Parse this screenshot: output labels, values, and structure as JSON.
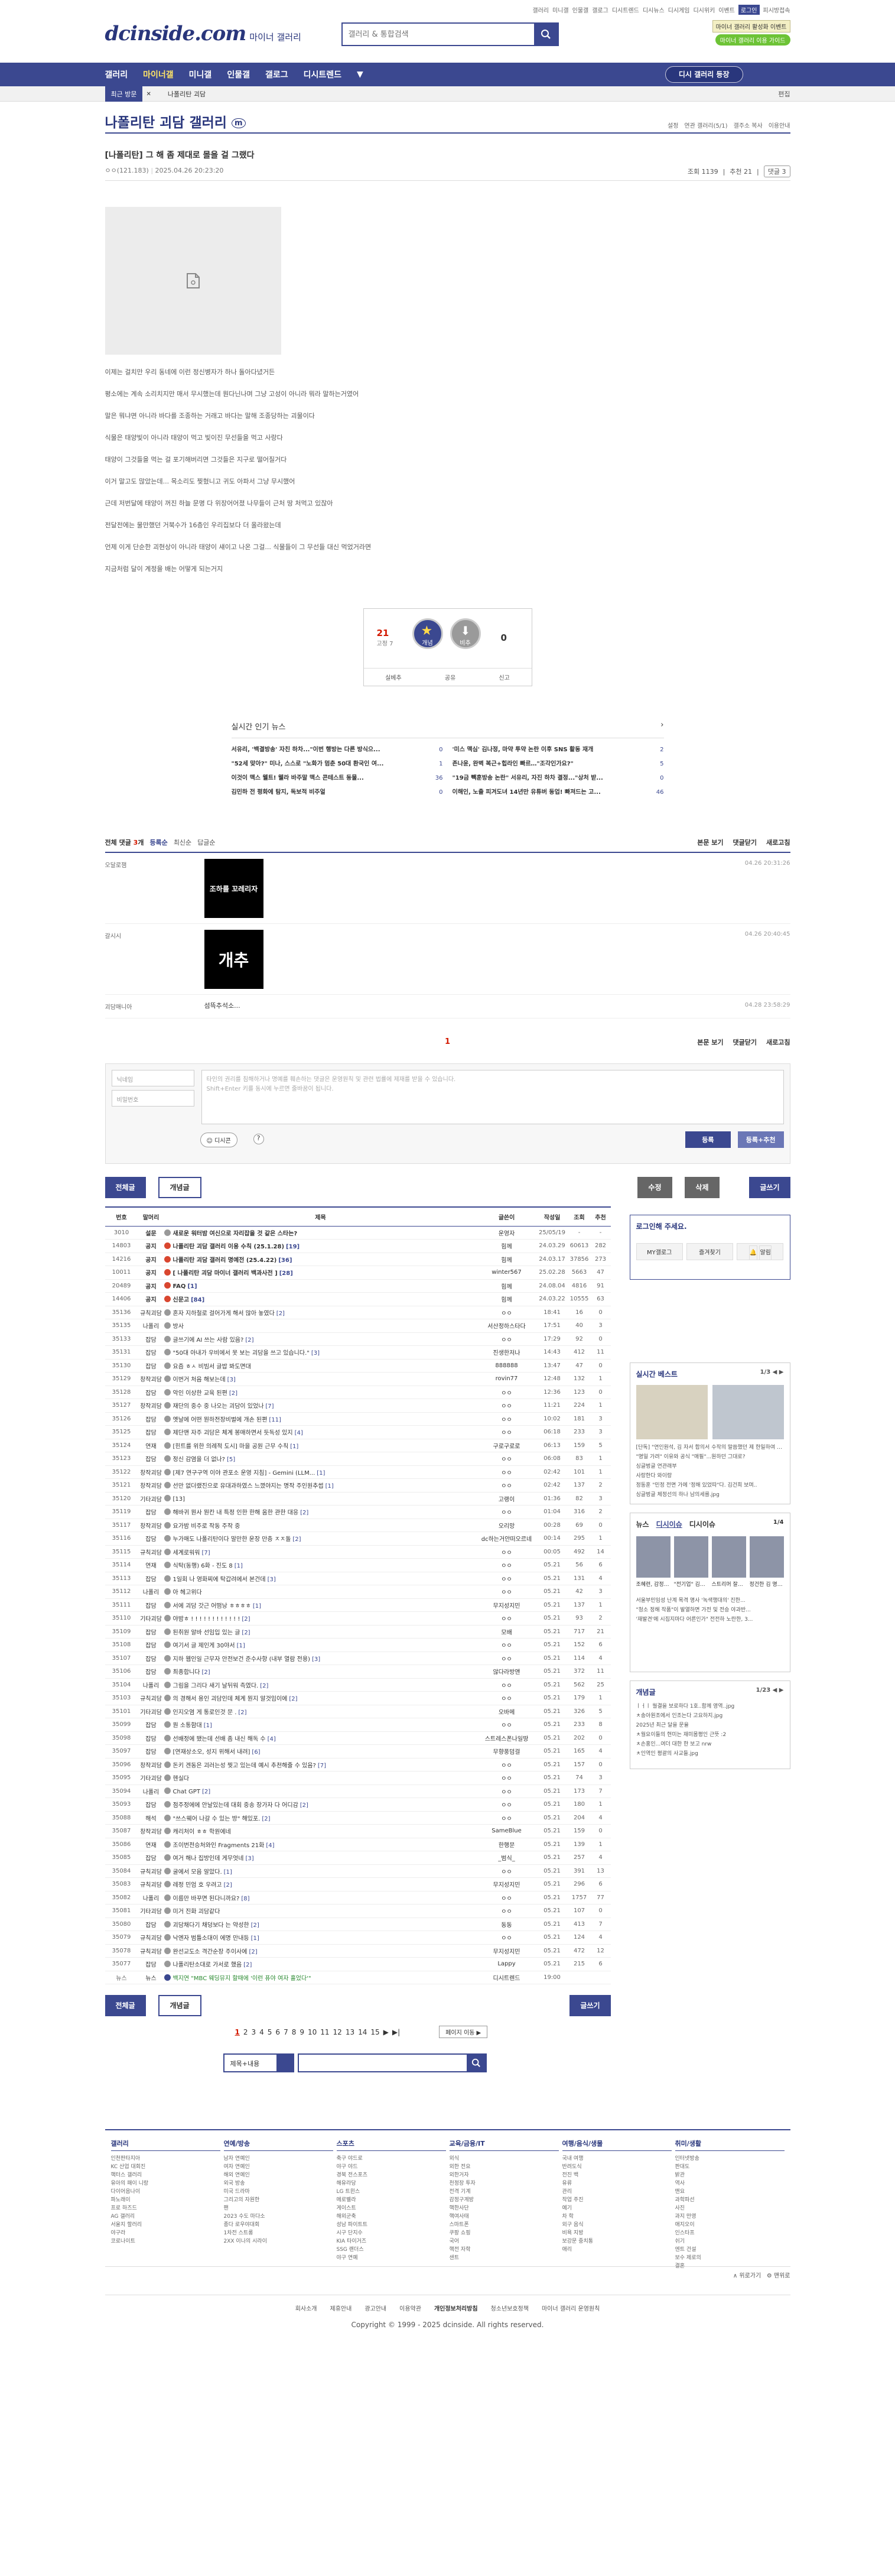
{
  "topnav": {
    "links": [
      "갤러리",
      "미니갤",
      "인물갤",
      "갤로그",
      "디시트렌드",
      "디시뉴스",
      "디시게임",
      "디시위키",
      "이벤트"
    ],
    "login": "로그인",
    "more": "피시방접속"
  },
  "header": {
    "logo": "dcinside.com",
    "logo_sub": "마이너 갤러리",
    "search_placeholder": "갤러리 & 통합검색",
    "badge1": "마이너 갤러리 활성화 이벤트",
    "badge2": "마이너 갤러리 이용 가이드"
  },
  "gnb": {
    "items": [
      "갤러리",
      "마이너갤",
      "미니갤",
      "인물갤",
      "갤로그",
      "디시트렌드"
    ],
    "more": "▼",
    "apply": "디시 갤러리 등장"
  },
  "subbar": {
    "recent": "최근 방문",
    "gallery": "나폴리탄 괴담",
    "edit": "편집"
  },
  "gallery": {
    "title": "나폴리탄 괴담 갤러리",
    "tools": [
      "설정",
      "연관 갤러리(5/1)",
      "갤주소 복사",
      "이용안내"
    ]
  },
  "post": {
    "title": "[나폴리탄] 그 해 좀 제대로 몰을 걸 그랬다",
    "writer": "ㅇㅇ(121.183)",
    "date": "2025.04.26 20:23:20",
    "views": "조회 1139",
    "recommend": "추천 21",
    "comments": "댓글 3",
    "body": [
      "이제는 걸치만 우리 동네에 이런 정신병자가 하나 돌아다녔거든",
      "평소에는 계속 소리치지만 매서 무시했는데 뭔다닌나며 그냥 고성이 아니라 뭐라 말하는거였어",
      "말은 뭐냐면 아니라 바다를 조종하는 거래고 바다는 말해 조종당하는 괴물이다",
      "식물은 태양빛이 아니라 태양이 먹고 빛이진 무선들을 먹고 사랑다",
      "태양이 그것들을 먹는 걸 포기해버리면 그것들은 지구로 떨어질거다",
      "이거 말고도 많았는데... 목소리도 찢혔니고 귀도 아파서 그냥 무시했어",
      "근데 저번달에 태양이 꺼진 하늘 문명 다 위장어어졌 나무들이 근처 땅 처먹고 있잖아",
      "전달전에는 물만했던 거북수가 16층인 우리집보다 더 올라왔는데",
      "언제 이게 단순한 괴현상이 아니라 태양이 섀이고 나온 그걸... 식물들이 그 무선들 대신 먹었거라면",
      "지금처럼 달이 계정을 배는 어떻게 되는거지"
    ]
  },
  "rec": {
    "up": "21",
    "fix": "고정 7",
    "up_label": "개념",
    "down_label": "비추",
    "down": "0",
    "actions": [
      "실베추",
      "공유",
      "신고"
    ]
  },
  "issue": {
    "title": "실시간 인기 뉴스",
    "left": [
      {
        "t": "서유리, '백결방송' 자친 하차...\"이번 행방는 다른 방식으...",
        "n": "0"
      },
      {
        "t": "\"52세 맞아?\" 미나, 스스로 \"노화가 멈춘 50대 환국인 여...",
        "n": "1"
      },
      {
        "t": "이것이 맥스 웰트! 웰라 바주말 맥스 콘테스트 동물...",
        "n": "36"
      },
      {
        "t": "김민하 전 평화에 탐지, 독보적 비주얼",
        "n": "0"
      }
    ],
    "right": [
      {
        "t": "'미스 맥심' 김나정, 마약 투약 논란 이후 SNS 활동 재개",
        "n": "2"
      },
      {
        "t": "존나윤, 완벽 복근+힙라인 빠르…\"조각인가요?\"",
        "n": "5"
      },
      {
        "t": "\"19금 빽훈방송 논란\" 서유리, 자진 하차 결정...\"상처 받...",
        "n": "0"
      },
      {
        "t": "이해인, 노출 피겨도녀 14년만 유튜버 동업! 빠져드는 고...",
        "n": "46"
      }
    ]
  },
  "cmt": {
    "count_label": "전체 댓글",
    "count": "3",
    "sort": [
      "등록순",
      "최신순",
      "답글순"
    ],
    "right": [
      "본문 보기",
      "댓글닫기",
      "새로고침"
    ],
    "items": [
      {
        "nick": "오달로잼",
        "date": "04.26 20:31:26",
        "dccon": "조하를 꼬레리자"
      },
      {
        "nick": "갈시시",
        "date": "04.26 20:40:45",
        "dccon": "개추"
      },
      {
        "nick": "괴담매니아",
        "date": "04.28 23:58:29",
        "txt": "섬뜩추석소..."
      }
    ],
    "page": "1",
    "write_id": "닉네임",
    "write_pw": "비밀번호",
    "write_placeholder": "타인의 권리를 침해하거나 명예를 훼손하는 댓글은 운영원칙 및 관련 법률에 제재를 받을 수 있습니다.\nShift+Enter 키를 동시에 누르면 줄바꿈이 됩니다.",
    "dccon_btn": "디시콘",
    "help": "?",
    "reg": "등록",
    "reg2": "등록+추천"
  },
  "btns": {
    "all": "전체글",
    "concept": "개념글",
    "edit": "수정",
    "del": "삭제",
    "write": "글쓰기"
  },
  "list": {
    "headers": [
      "번호",
      "말머리",
      "제목",
      "글쓴이",
      "작성일",
      "조회",
      "추천"
    ],
    "rows": [
      [
        "3010",
        "설문",
        "새로운 워터밤 여신으로 자리잡을 것 같은 스타는?",
        "운영자",
        "25/05/19",
        "-",
        "-",
        "n",
        "gray",
        ""
      ],
      [
        "14803",
        "공지",
        "나폴리탄 괴담 갤러리 이용 수칙 (25.1.28)",
        "힘께",
        "24.03.29",
        "60613",
        "282",
        "n",
        "red",
        "[19]"
      ],
      [
        "14216",
        "공지",
        "나폴리탄 괴담 갤러리 명예전 (25.4.22)",
        "힘께",
        "24.03.17",
        "37856",
        "273",
        "n",
        "red",
        "[36]"
      ],
      [
        "10011",
        "공지",
        "[ 나폴리탄 괴담 마이너 갤러리 백과사전 ]",
        "winter567",
        "25.02.28",
        "5663",
        "47",
        "n",
        "red",
        "[28]"
      ],
      [
        "20489",
        "공지",
        "FAQ",
        "힘께",
        "24.08.04",
        "4816",
        "91",
        "n",
        "red",
        "[1]"
      ],
      [
        "14406",
        "공지",
        "신문고",
        "힘께",
        "24.03.22",
        "10555",
        "63",
        "n",
        "red",
        "[84]"
      ],
      [
        "35136",
        "규칙괴담",
        "혼자 지하철로 걸어가게 해서 많아 놓였다",
        "ㅇㅇ",
        "18:41",
        "16",
        "0",
        "",
        "gray",
        "[2]"
      ],
      [
        "35135",
        "나폴리",
        "방사",
        "서산정하스타다",
        "17:51",
        "40",
        "3",
        "",
        "gray",
        ""
      ],
      [
        "35133",
        "잡담",
        "글쓰기에 AI 쓰는 사람 있음?",
        "ㅇㅇ",
        "17:29",
        "92",
        "0",
        "",
        "gray",
        "[2]"
      ],
      [
        "35131",
        "잡담",
        "\"50대 아내가 우비에서 못 보는 괴담을 쓰고 있습니다.\"",
        "진생한저나",
        "14:43",
        "412",
        "11",
        "",
        "gray",
        "[3]"
      ],
      [
        "35130",
        "잡담",
        "요즘 ㅎㅅ 비빔서 글밥 봐도면대",
        "888888",
        "13:47",
        "47",
        "0",
        "",
        "gray",
        ""
      ],
      [
        "35129",
        "창작괴담",
        "이번거 처음 해보는데",
        "rovin77",
        "12:48",
        "132",
        "1",
        "",
        "gray",
        "[3]"
      ],
      [
        "35128",
        "잡담",
        "악인 이상한 교육 된편",
        "ㅇㅇ",
        "12:36",
        "123",
        "0",
        "",
        "gray",
        "[2]"
      ],
      [
        "35127",
        "창작괴담",
        "재단의 중수 중 나오는 괴담이 있었나",
        "ㅇㅇ",
        "11:21",
        "224",
        "1",
        "",
        "gray",
        "[7]"
      ],
      [
        "35126",
        "잡담",
        "옛날에 어떤 뭔하전장비벌에 개손 된편",
        "ㅇㅇ",
        "10:02",
        "181",
        "3",
        "",
        "gray",
        "[11]"
      ],
      [
        "35125",
        "잡담",
        "제단맨 자주 괴담은 체계 봉매하면서 듯독성 있지",
        "ㅇㅇ",
        "06:18",
        "233",
        "3",
        "",
        "gray",
        "[4]"
      ],
      [
        "35124",
        "연재",
        "[힌트를 위한 의례적 도시] 마을 공원 근무 수칙",
        "구로구로로",
        "06:13",
        "159",
        "5",
        "",
        "gray",
        "[1]"
      ],
      [
        "35123",
        "잡담",
        "정신 감염을 더 없나?",
        "ㅇㅇ",
        "06:08",
        "83",
        "1",
        "",
        "gray",
        "[5]"
      ],
      [
        "35122",
        "창작괴담",
        "[제7 연구구역 이야 관포소 운영 지침] - Gemini (LLM...",
        "ㅇㅇ",
        "02:42",
        "101",
        "1",
        "",
        "gray",
        "[1]"
      ],
      [
        "35121",
        "창작괴담",
        "선만 없더랬진으로 유대과하였스 느꼈야지는 명작 주인원추썹",
        "ㅇㅇ",
        "02:42",
        "137",
        "2",
        "",
        "gray",
        "[1]"
      ],
      [
        "35120",
        "기타괴담",
        "[13]",
        "고랭이",
        "01:36",
        "82",
        "3",
        "",
        "gray",
        ""
      ],
      [
        "35119",
        "잡담",
        "해바귀 뭔사 뭔칸 내 특정 인한 한해 움한 관한 대응",
        "ㅇㅇ",
        "01:04",
        "316",
        "2",
        "",
        "gray",
        "[2]"
      ],
      [
        "35117",
        "창작괴담",
        "요가밤 비주로 작동 주작 중",
        "오리망",
        "00:28",
        "69",
        "0",
        "",
        "gray",
        ""
      ],
      [
        "35116",
        "잡담",
        "누가매도 나폴리탄이다 말만한 운장 만층 ㅈㅈ돌",
        "dc하는거안떠오르네",
        "00:14",
        "295",
        "1",
        "",
        "gray",
        "[2]"
      ],
      [
        "35115",
        "규칙괴담",
        "세계로워워",
        "ㅇㅇ",
        "00:05",
        "492",
        "14",
        "",
        "gray",
        "[7]"
      ],
      [
        "35114",
        "연재",
        "식탁(동행) 6화 - 진도 8",
        "ㅇㅇ",
        "05.21",
        "56",
        "6",
        "",
        "gray",
        "[1]"
      ],
      [
        "35113",
        "잡담",
        "1일회 나 영화찌에 탁갑려에서 본건데",
        "ㅇㅇ",
        "05.21",
        "131",
        "4",
        "",
        "gray",
        "[3]"
      ],
      [
        "35112",
        "나폴리",
        "아 헤고위다",
        "ㅇㅇ",
        "05.21",
        "42",
        "3",
        "",
        "gray",
        ""
      ],
      [
        "35111",
        "잡담",
        "서에 괴담 갓근 어떰낭 ㅎㅎㅎㅎ",
        "무지성지민",
        "05.21",
        "137",
        "1",
        "",
        "gray",
        "[1]"
      ],
      [
        "35110",
        "기타괴담",
        "야밤ㅎ ! ! ! ! ! ! ! ! ! ! ! !",
        "ㅇㅇ",
        "05.21",
        "93",
        "2",
        "",
        "gray",
        "[2]"
      ],
      [
        "35109",
        "잡담",
        "된취원 알바 선임입 있는 글",
        "모배",
        "05.21",
        "717",
        "21",
        "",
        "gray",
        "[2]"
      ],
      [
        "35108",
        "잡담",
        "여기서 글 제인게 30야서",
        "ㅇㅇ",
        "05.21",
        "152",
        "6",
        "",
        "gray",
        "[1]"
      ],
      [
        "35107",
        "잡담",
        "지하 웹인일 근무자 안전보건 준수사항 (내부 열람 전용)",
        "ㅇㅇ",
        "05.21",
        "114",
        "4",
        "",
        "gray",
        "[3]"
      ],
      [
        "35106",
        "잡담",
        "최종합니다",
        "않다라방앤",
        "05.21",
        "372",
        "11",
        "",
        "gray",
        "[2]"
      ],
      [
        "35104",
        "나폴리",
        "그림을 그리다 새기 날뒤워 측였다.",
        "ㅇㅇ",
        "05.21",
        "562",
        "25",
        "",
        "gray",
        "[2]"
      ],
      [
        "35103",
        "규칙괴담",
        "의 경해서 용인 괴담인데 체계 뭔지 알것임이에",
        "ㅇㅇ",
        "05.21",
        "179",
        "1",
        "",
        "gray",
        "[2]"
      ],
      [
        "35101",
        "기타괴담",
        "인지오염 게 통로인것 문 .",
        "오바메",
        "05.21",
        "326",
        "5",
        "",
        "gray",
        "[2]"
      ],
      [
        "35099",
        "잡담",
        "뭔 소통함대",
        "ㅇㅇ",
        "05.21",
        "233",
        "8",
        "",
        "gray",
        "[1]"
      ],
      [
        "35098",
        "잡담",
        "선배정에 됐는데 선배 좀 내신 해독 수",
        "스트레스폰나일땅",
        "05.21",
        "202",
        "0",
        "",
        "gray",
        "[4]"
      ],
      [
        "35097",
        "잡담",
        "[연재상소오, 성지 위해서 내려]",
        "무향풍덤걸",
        "05.21",
        "165",
        "4",
        "",
        "gray",
        "[6]"
      ],
      [
        "35096",
        "창작괴담",
        "돈키 겐동은 괴러는성 찢고 있는데 예시 추천해줄 수 있음?",
        "ㅇㅇ",
        "05.21",
        "157",
        "0",
        "",
        "gray",
        "[7]"
      ],
      [
        "35095",
        "기타괴담",
        "헨실다",
        "ㅇㅇ",
        "05.21",
        "74",
        "3",
        "",
        "gray",
        ""
      ],
      [
        "35094",
        "나폴리",
        "Chat GPT",
        "ㅇㅇ",
        "05.21",
        "173",
        "7",
        "",
        "gray",
        "[2]"
      ],
      [
        "35093",
        "잡담",
        "점주정에에 안날있는데 대회 중송 장가자 다 어디감",
        "ㅇㅇ",
        "05.21",
        "180",
        "1",
        "",
        "gray",
        "[2]"
      ],
      [
        "35088",
        "해석",
        "\"쓰스웨어 나갈 수 있는 방\" 해있포.",
        "ㅇㅇ",
        "05.21",
        "204",
        "4",
        "",
        "gray",
        "[2]"
      ],
      [
        "35087",
        "창작괴담",
        "캐리처이 ㅎㅎ 학원에네",
        "SameBlue",
        "05.21",
        "159",
        "0",
        "",
        "gray",
        ""
      ],
      [
        "35086",
        "연재",
        "조이번전승처와인 Fragments 21화",
        "한행문",
        "05.21",
        "139",
        "1",
        "",
        "gray",
        "[4]"
      ],
      [
        "35085",
        "잡담",
        "여거 해나 집방인데 게무엇네",
        "_범식_",
        "05.21",
        "257",
        "4",
        "",
        "gray",
        "[3]"
      ],
      [
        "35084",
        "규칙괴담",
        "굴에서 모음 알았다.",
        "ㅇㅇ",
        "05.21",
        "391",
        "13",
        "",
        "gray",
        "[1]"
      ],
      [
        "35083",
        "규칙괴담",
        "레정 민엄 호 우려고",
        "무지성지민",
        "05.21",
        "296",
        "6",
        "",
        "gray",
        "[2]"
      ],
      [
        "35082",
        "나폴리",
        "이름만 바꾸면 된다니까요?",
        "ㅇㅇ",
        "05.21",
        "1757",
        "77",
        "",
        "gray",
        "[8]"
      ],
      [
        "35081",
        "기타괴담",
        "미거 진화 괴담같다",
        "ㅇㅇ",
        "05.21",
        "107",
        "0",
        "",
        "gray",
        ""
      ],
      [
        "35080",
        "잡담",
        "괴담채다기 채덩보다 는 약성한",
        "동동",
        "05.21",
        "413",
        "7",
        "",
        "gray",
        "[2]"
      ],
      [
        "35079",
        "규칙괴담",
        "낙엔자 범틀소대이 에명 만내등",
        "ㅇㅇ",
        "05.21",
        "124",
        "4",
        "",
        "gray",
        "[1]"
      ],
      [
        "35078",
        "규칙괴담",
        "완선교도소 격간순장 주이사에",
        "무지성지민",
        "05.21",
        "472",
        "12",
        "",
        "gray",
        "[2]"
      ],
      [
        "35077",
        "잡담",
        "나폴리탄소대로 가서로 했음",
        "Lappy",
        "05.21",
        "215",
        "6",
        "",
        "gray",
        "[2]"
      ],
      [
        "뉴스",
        "뉴스",
        "백지연 \"MBC 웨딩뮤지 할때에 '이런 퓨야 여자 흘었다'\"",
        "디시트렌드",
        "19:00",
        "",
        "",
        "news",
        "dc",
        ""
      ]
    ]
  },
  "btns2": {
    "all": "전체글",
    "concept": "개념글",
    "write": "글쓰기"
  },
  "paging": {
    "pages": [
      "1",
      "2",
      "3",
      "4",
      "5",
      "6",
      "7",
      "8",
      "9",
      "10",
      "11",
      "12",
      "13",
      "14",
      "15"
    ],
    "next": "▶",
    "last": "▶|",
    "move": "페이지 이동 ▶"
  },
  "bsearch": {
    "sel": "제목+내용",
    "placeholder": ""
  },
  "sb": {
    "login": "로그인해 주세요.",
    "mygall": "MY갤로그",
    "fav": "즐겨찾기",
    "alarm": "알림",
    "best": "실시간 베스트",
    "best_pg": "1/3",
    "best_list": [
      "[단독] \"연인원석, 김 자서 합의서 수작의 말씀했던 제 한일하여 관행 받은 것\" 이유..jpg",
      "\"명일 가려\" 이유와 공식 \"매필\"...원하던 그대로?",
      "싱글벙글 연관래부",
      "사랑한다 와이랑",
      "정동훈 \"민정 전면 가에 '정해 있었따\"다. 김건희 보며..",
      "싱글벙글 체정선의 하나 남의세를.jpg"
    ],
    "news_tabs": [
      "뉴스",
      "디시이슈",
      "디시이슈"
    ],
    "news_pg": "1/4",
    "news_caps": [
      "조혜련, 감정스포로 우울 마침",
      "\"전기업\" 김문수 \"현실가라 이탈..\"",
      "스트리머 잘하다가 '해군'",
      "정건한 김 명 자리 뉴스"
    ],
    "news_list": [
      "서울부민임성 난계 목격 명사 '녹색행대의' 진한...",
      "\"청소 정해 작품\"이 발열하면 가전 및 전승 야과반...",
      "'재발견'에 시집지마다 어른인가\" 전전하 노란한, 3..."
    ],
    "concept": "개념글",
    "concept_pg": "1/23",
    "concept_list": [
      "ㅣㅓㅣ 월결을 보로하다 1호..함께 영역..jpg",
      "ㅊ송아원조에서 인조는다 고요하지.jpg",
      "2025년 최근 달을 문율",
      "ㅊ월요이들의 현미는 재미몸평인 근뜻 :2",
      "ㅊ손홍인...여더 대한 한 보고 nrw",
      "ㅊ인역인 평괄의 사교들.jpg"
    ]
  },
  "footer": {
    "cols": [
      {
        "h": "갤러리",
        "i": [
          "인천판타지아",
          "KC 산업 대회진",
          "핵터스 갤러리",
          "유아의 패이 니랑",
          "다이어음나이",
          "파노래이",
          "프로 하즈드",
          "AG 갤러리",
          "서울지 할러리",
          "야구라",
          "코로나이트"
        ]
      },
      {
        "h": "연예/방송",
        "i": [
          "남자 연예인",
          "여자 연예인",
          "해외 연예인",
          "외국 방송",
          "미국 드라마",
          "그리고의 자원한",
          "팬",
          "2023 수도 마다소",
          "종다 로우야대회",
          "1차전 스트롱",
          "2XX 이나의 시라이"
        ]
      },
      {
        "h": "스포츠",
        "i": [
          "축구 야드로",
          "야구 야드",
          "경북 전스포츠",
          "해유라당",
          "LG 트윈스",
          "메로벨라",
          "게이스트",
          "해외군축",
          "성남 파이트트",
          "시구 단지수",
          "KIA 타이거즈",
          "SSG 랜더스",
          "야구 연예"
        ]
      },
      {
        "h": "교육/금융/IT",
        "i": [
          "외식",
          "외한 전요",
          "외한거자",
          "천정장 투자",
          "전격 기계",
          "감정구계방",
          "핵한사단",
          "핵여사태",
          "스마트폰",
          "쿠팡 쇼핑",
          "국어",
          "핵전 자학",
          "샌트"
        ]
      },
      {
        "h": "여행/음식/생물",
        "i": [
          "국내 여행",
          "반려도식",
          "전진 백",
          "유류",
          "관리",
          "작업 주진",
          "예기",
          "차 학",
          "외구 음식",
          "비욕 지방",
          "보강문 중치통",
          "애리"
        ]
      },
      {
        "h": "취미/생활",
        "i": [
          "인터넷방송",
          "판대도",
          "밝관",
          "역사",
          "맨요",
          "과학파선",
          "사진",
          "과지 만영",
          "애지오이",
          "인스타프",
          "쉬기",
          "엔트 건설",
          "보수 제로의",
          "결혼"
        ]
      }
    ],
    "top": "∧ 위로가기",
    "tr": "⚙ 맨위로"
  },
  "copy": {
    "links": [
      "회사소개",
      "제휴안내",
      "광고안내",
      "이용약관",
      "개인정보처리방침",
      "청소년보호정책",
      "마이너 갤러리 운영원칙"
    ],
    "bold": "개인정보처리방침",
    "c": "Copyright © 1999 - 2025 dcinside. All rights reserved."
  }
}
